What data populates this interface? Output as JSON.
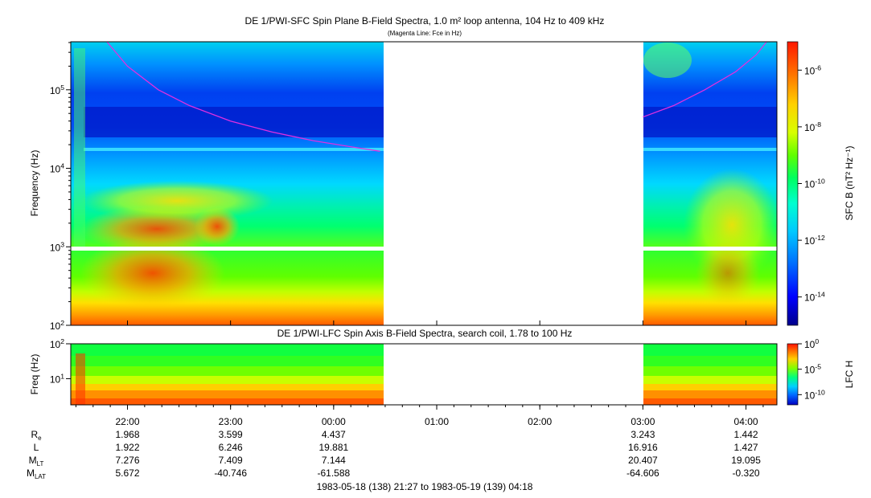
{
  "title": "DE 1/PWI-SFC  Spin Plane B-Field Spectra, 1.0 m² loop antenna, 104 Hz to 409 kHz",
  "subtitle": "(Magenta Line: Fce in Hz)",
  "colors": {
    "fce_line": "#e030e0",
    "gap": "#ffffff",
    "colorscale": [
      "#00008b",
      "#0000ff",
      "#0070ff",
      "#00c8ff",
      "#00ffd0",
      "#00ff60",
      "#60ff00",
      "#d8ff00",
      "#ffd000",
      "#ff7000",
      "#ff1800"
    ]
  },
  "chart_data": [
    {
      "type": "heatmap",
      "title": "DE 1/PWI-SFC  Spin Plane B-Field Spectra, 1.0 m² loop antenna, 104 Hz to 409 kHz",
      "subtitle": "(Magenta Line: Fce in Hz)",
      "ylabel": "Frequency (Hz)",
      "yscale": "log",
      "ylim": [
        100,
        409000
      ],
      "ytick_labels": [
        "10^2",
        "10^3",
        "10^4",
        "10^5"
      ],
      "yticks": [
        100,
        1000,
        10000,
        100000
      ],
      "xlim_hours": [
        21.45,
        28.3
      ],
      "data_gaps_hours": [
        [
          24.48,
          27.0
        ]
      ],
      "frequency_gap_hz": [
        920,
        1000
      ],
      "colorbar": {
        "label": "SFC B (nT² Hz⁻¹)",
        "scale": "log",
        "range": [
          1e-15,
          1e-05
        ],
        "tick_labels": [
          "10^-6",
          "10^-8",
          "10^-10",
          "10^-12",
          "10^-14"
        ],
        "ticks": [
          1e-06,
          1e-08,
          1e-10,
          1e-12,
          1e-14
        ]
      },
      "fce_line": {
        "name": "Fce",
        "x_hours": [
          21.8,
          22.0,
          22.3,
          22.6,
          23.0,
          23.4,
          23.8,
          24.2,
          24.45,
          27.0,
          27.3,
          27.6,
          27.9,
          28.1,
          28.2
        ],
        "y_hz": [
          409000,
          200000,
          100000,
          63000,
          40000,
          29000,
          22500,
          18500,
          16500,
          45000,
          63000,
          100000,
          170000,
          280000,
          409000
        ]
      }
    },
    {
      "type": "heatmap",
      "title": "DE 1/PWI-LFC  Spin Axis B-Field Spectra, search coil, 1.78 to 100 Hz",
      "ylabel": "Freq (Hz)",
      "yscale": "log",
      "ylim": [
        1.78,
        100
      ],
      "ytick_labels": [
        "10^1",
        "10^2"
      ],
      "yticks": [
        10,
        100
      ],
      "data_gaps_hours": [
        [
          24.48,
          27.0
        ]
      ],
      "colorbar": {
        "label": "LFC H",
        "scale": "log",
        "range": [
          1e-12,
          1
        ],
        "tick_labels": [
          "10^0",
          "10^-5",
          "10^-10"
        ],
        "ticks": [
          1,
          1e-05,
          1e-10
        ]
      }
    }
  ],
  "x_axis": {
    "tick_labels": [
      "22:00",
      "23:00",
      "00:00",
      "01:00",
      "02:00",
      "03:00",
      "04:00"
    ],
    "ticks_hours": [
      22,
      23,
      24,
      25,
      26,
      27,
      28
    ]
  },
  "ephemeris": {
    "rows": [
      {
        "label": "R",
        "sub": "e",
        "values": [
          "1.968",
          "3.599",
          "4.437",
          "",
          "",
          "3.243",
          "1.442"
        ]
      },
      {
        "label": "L",
        "sub": "",
        "values": [
          "1.922",
          "6.246",
          "19.881",
          "",
          "",
          "16.916",
          "1.427"
        ]
      },
      {
        "label": "M",
        "sub": "LT",
        "values": [
          "7.276",
          "7.409",
          "7.144",
          "",
          "",
          "20.407",
          "19.095"
        ]
      },
      {
        "label": "M",
        "sub": "LAT",
        "values": [
          "5.672",
          "-40.746",
          "-61.588",
          "",
          "",
          "-64.606",
          "-0.320"
        ]
      }
    ]
  },
  "time_range": "1983-05-18 (138) 21:27 to 1983-05-19 (139) 04:18"
}
